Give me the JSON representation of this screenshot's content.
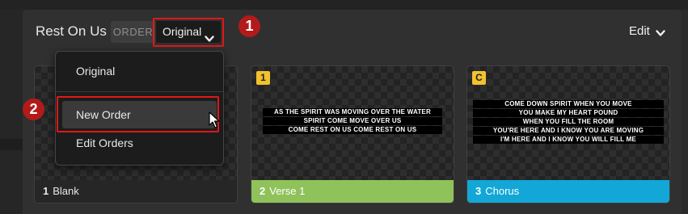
{
  "header": {
    "song_title": "Rest On Us",
    "order_label": "ORDER",
    "order_value": "Original",
    "edit_label": "Edit"
  },
  "dropdown": {
    "items": [
      {
        "label": "Original"
      },
      {
        "label": "New Order"
      },
      {
        "label": "Edit Orders"
      }
    ]
  },
  "annotations": {
    "step1": "1",
    "step2": "2"
  },
  "slides": [
    {
      "number": "1",
      "label": "Blank",
      "tag": "",
      "lines": []
    },
    {
      "number": "2",
      "label": "Verse 1",
      "tag": "1",
      "lines": [
        "AS THE SPIRIT WAS MOVING OVER THE WATER",
        "SPIRIT COME MOVE OVER US",
        "COME REST ON US COME REST ON US"
      ]
    },
    {
      "number": "3",
      "label": "Chorus",
      "tag": "C",
      "lines": [
        "COME DOWN SPIRIT WHEN YOU MOVE",
        "YOU MAKE  MY HEART POUND",
        "WHEN YOU FILL THE ROOM",
        "YOU'RE HERE AND I KNOW YOU ARE MOVING",
        "I'M HERE AND I KNOW YOU WILL FILL ME"
      ]
    }
  ],
  "colors": {
    "verse": "#8fc25a",
    "chorus": "#12a7d6",
    "tag": "#f2c12e",
    "highlight": "#e01818"
  }
}
